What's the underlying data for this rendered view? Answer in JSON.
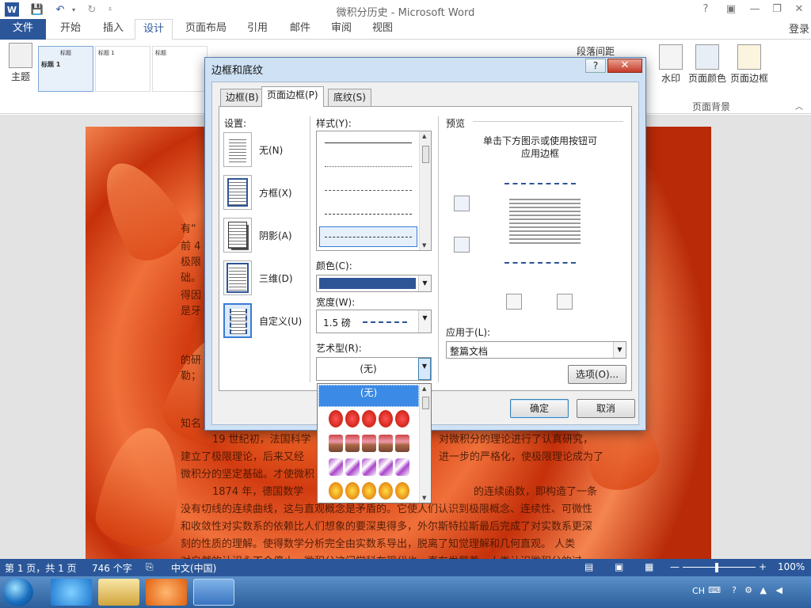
{
  "titlebar": {
    "title": "微积分历史 - Microsoft Word",
    "word_icon": "W"
  },
  "ribbon": {
    "tabs": [
      "文件",
      "开始",
      "插入",
      "设计",
      "页面布局",
      "引用",
      "邮件",
      "审阅",
      "视图"
    ],
    "active_tab": "设计",
    "login": "登录",
    "theme_label": "主题",
    "style_boxes": [
      "标题",
      "标题 1",
      "标题",
      "标题"
    ],
    "style_preview_1": "标题 1",
    "paragraph_spacing": "段落间距",
    "watermark": "水印",
    "page_color": "页面颜色",
    "page_border": "页面边框",
    "page_background_group": "页面背景"
  },
  "dialog": {
    "title": "边框和底纹",
    "help": "?",
    "close": "✕",
    "tabs": [
      "边框(B)",
      "页面边框(P)",
      "底纹(S)"
    ],
    "active_tab": "页面边框(P)",
    "settings_label": "设置:",
    "settings": [
      "无(N)",
      "方框(X)",
      "阴影(A)",
      "三维(D)",
      "自定义(U)"
    ],
    "selected_setting": "自定义(U)",
    "style_label": "样式(Y):",
    "color_label": "颜色(C):",
    "color_value": "#2e5596",
    "width_label": "宽度(W):",
    "width_value": "1.5 磅",
    "art_label": "艺术型(R):",
    "art_value": "(无)",
    "preview_label": "预览",
    "preview_hint_1": "单击下方图示或使用按钮可",
    "preview_hint_2": "应用边框",
    "apply_to_label": "应用于(L):",
    "apply_to_value": "整篇文档",
    "options_button": "选项(O)...",
    "ok_button": "确定",
    "cancel_button": "取消",
    "art_dropdown_selected": "(无)"
  },
  "document": {
    "lines": [
      "有“",
      "前 4",
      "极限",
      "础。",
      "得因",
      "是牙",
      "的研",
      "勒；",
      "知名",
      "19 世纪初，法国科学",
      "对微积分的理论进行了认真研究，",
      "建立了极限理论，后来又经",
      "进一步的严格化，使极限理论成为了",
      "微积分的坚定基础。才使微积",
      "1874 年，德国数学",
      "的连续函数，即构造了一条",
      "没有切线的连续曲线，这与直观概念是矛盾的。它使人们认识到极限概念、连续性、可微性",
      "和收敛性对实数系的依赖比人们想象的要深奥得多，外尔斯特拉斯最后完成了对实数系更深",
      "刻的性质的理解。使得数学分析完全由实数系导出，脱离了知觉理解和几何直观。 人类",
      "对自然的认识永不会停止，微积分这门学科在现代也一直在发展着，人类认识微积分的过"
    ]
  },
  "statusbar": {
    "page": "第 1 页，共 1 页",
    "words": "746 个字",
    "language": "中文(中国)",
    "zoom": "100%"
  },
  "taskbar": {
    "ime": "CH"
  }
}
